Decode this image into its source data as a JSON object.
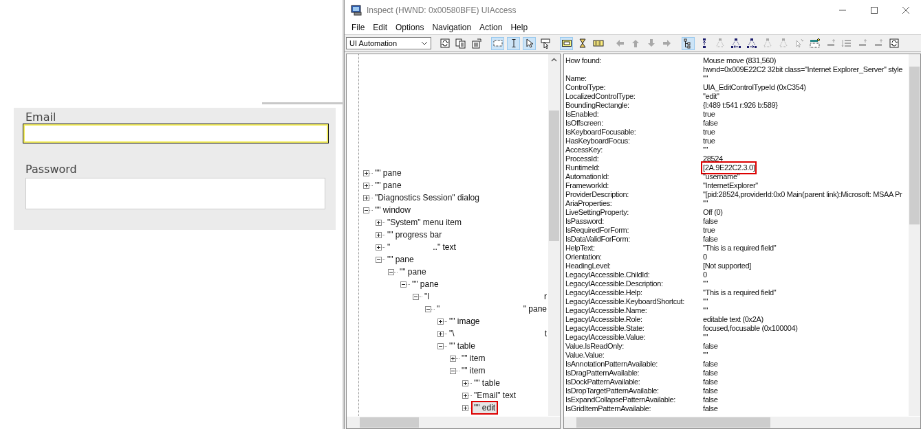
{
  "web_form": {
    "fields": [
      {
        "label": "Email",
        "focused": true
      },
      {
        "label": "Password",
        "focused": false
      }
    ]
  },
  "window": {
    "title": "Inspect  (HWND: 0x00580BFE) UIAccess",
    "menu": [
      "File",
      "Edit",
      "Options",
      "Navigation",
      "Action",
      "Help"
    ],
    "mode_dropdown": {
      "value": "UI Automation"
    },
    "toolbar": [
      [
        {
          "kind": "refresh",
          "selected": false,
          "disabled": false
        },
        {
          "kind": "copy",
          "selected": false,
          "disabled": false
        },
        {
          "kind": "properties",
          "selected": false,
          "disabled": false
        }
      ],
      [
        {
          "kind": "rectangle",
          "selected": true,
          "disabled": false
        },
        {
          "kind": "ibeam",
          "selected": true,
          "disabled": false
        },
        {
          "kind": "pointer",
          "selected": true,
          "disabled": false
        },
        {
          "kind": "hover",
          "selected": false,
          "disabled": false
        }
      ],
      [
        {
          "kind": "highlight",
          "selected": true,
          "disabled": false
        },
        {
          "kind": "hourglass",
          "selected": false,
          "disabled": false
        },
        {
          "kind": "keyboard",
          "selected": false,
          "disabled": false
        }
      ],
      [
        {
          "kind": "arrow-left",
          "selected": false,
          "disabled": true
        },
        {
          "kind": "arrow-up",
          "selected": false,
          "disabled": true
        },
        {
          "kind": "arrow-down",
          "selected": false,
          "disabled": true
        },
        {
          "kind": "arrow-right",
          "selected": false,
          "disabled": true
        }
      ],
      [
        {
          "kind": "tree",
          "selected": true,
          "disabled": false
        },
        {
          "kind": "node-up",
          "selected": false,
          "disabled": false
        },
        {
          "kind": "node-tree",
          "selected": false,
          "disabled": true
        },
        {
          "kind": "node-left",
          "selected": false,
          "disabled": false
        },
        {
          "kind": "node-right",
          "selected": false,
          "disabled": false
        },
        {
          "kind": "node-tree",
          "selected": false,
          "disabled": true
        },
        {
          "kind": "node-tree",
          "selected": false,
          "disabled": true
        },
        {
          "kind": "sparkle",
          "selected": false,
          "disabled": true
        },
        {
          "kind": "marker",
          "selected": false,
          "disabled": false
        },
        {
          "kind": "line-add",
          "selected": false,
          "disabled": true
        },
        {
          "kind": "list",
          "selected": false,
          "disabled": true
        },
        {
          "kind": "line-add",
          "selected": false,
          "disabled": true
        },
        {
          "kind": "line-add",
          "selected": false,
          "disabled": true
        },
        {
          "kind": "refresh",
          "selected": false,
          "disabled": false
        }
      ]
    ]
  },
  "tree": [
    {
      "label": "\"\" pane",
      "expanded": false,
      "selected": false
    },
    {
      "label": "\"\" pane",
      "expanded": false,
      "selected": false
    },
    {
      "label": "\"Diagnostics Session\" dialog",
      "expanded": false,
      "selected": false
    },
    {
      "label": "\"\" window",
      "expanded": true,
      "selected": false,
      "children": [
        {
          "label": "\"System\" menu item",
          "expanded": false,
          "selected": false
        },
        {
          "label": "\"\" progress bar",
          "expanded": false,
          "selected": false
        },
        {
          "label": "\"",
          "tail_mid": "..\" text",
          "expanded": false,
          "selected": false
        },
        {
          "label": "\"\" pane",
          "expanded": true,
          "selected": false,
          "children": [
            {
              "label": "\"\" pane",
              "expanded": true,
              "selected": false,
              "children": [
                {
                  "label": "\"\" pane",
                  "expanded": true,
                  "selected": false,
                  "children": [
                    {
                      "label": "\"l",
                      "tail": "r",
                      "expanded": true,
                      "selected": false,
                      "children": [
                        {
                          "label": "\"",
                          "tail": "\" pane",
                          "expanded": true,
                          "selected": false,
                          "children": [
                            {
                              "label": "\"\" image",
                              "expanded": false,
                              "selected": false
                            },
                            {
                              "label": "\"\\",
                              "tail": "t",
                              "expanded": false,
                              "selected": false
                            },
                            {
                              "label": "\"\" table",
                              "expanded": true,
                              "selected": false,
                              "children": [
                                {
                                  "label": "\"\" item",
                                  "expanded": false,
                                  "selected": false
                                },
                                {
                                  "label": "\"\" item",
                                  "expanded": true,
                                  "selected": false,
                                  "children": [
                                    {
                                      "label": "\"\" table",
                                      "expanded": false,
                                      "selected": false
                                    },
                                    {
                                      "label": "\"Email\" text",
                                      "expanded": false,
                                      "selected": false
                                    },
                                    {
                                      "label": "\"\" edit",
                                      "expanded": false,
                                      "selected": true
                                    }
                                  ]
                                }
                              ]
                            }
                          ]
                        }
                      ]
                    }
                  ]
                }
              ]
            }
          ]
        }
      ]
    }
  ],
  "properties": [
    {
      "name": "How found:",
      "value": "Mouse move (831,560)",
      "highlighted": false
    },
    {
      "value": "hwnd=0x009E22C2 32bit class=\"Internet Explorer_Server\" style",
      "highlighted": false
    },
    {
      "name": "Name:",
      "value": "\"\"",
      "highlighted": false
    },
    {
      "name": "ControlType:",
      "value": "UIA_EditControlTypeId (0xC354)",
      "highlighted": false
    },
    {
      "name": "LocalizedControlType:",
      "value": "\"edit\"",
      "highlighted": false
    },
    {
      "name": "BoundingRectangle:",
      "value": "{l:489 t:541 r:926 b:589}",
      "highlighted": false
    },
    {
      "name": "IsEnabled:",
      "value": "true",
      "highlighted": false
    },
    {
      "name": "IsOffscreen:",
      "value": "false",
      "highlighted": false
    },
    {
      "name": "IsKeyboardFocusable:",
      "value": "true",
      "highlighted": false
    },
    {
      "name": "HasKeyboardFocus:",
      "value": "true",
      "highlighted": false
    },
    {
      "name": "AccessKey:",
      "value": "\"\"",
      "highlighted": false
    },
    {
      "name": "ProcessId:",
      "value": "28524",
      "highlighted": false
    },
    {
      "name": "RuntimeId:",
      "value": "[2A.9E22C2.3.0]",
      "highlighted": true
    },
    {
      "name": "AutomationId:",
      "value": "\"username\"",
      "highlighted": false
    },
    {
      "name": "FrameworkId:",
      "value": "\"InternetExplorer\"",
      "highlighted": false
    },
    {
      "name": "ProviderDescription:",
      "value": "\"[pid:28524,providerId:0x0 Main(parent link):Microsoft: MSAA Pr",
      "highlighted": false
    },
    {
      "name": "AriaProperties:",
      "value": "\"\"",
      "highlighted": false
    },
    {
      "name": "LiveSettingProperty:",
      "value": "Off (0)",
      "highlighted": false
    },
    {
      "name": "IsPassword:",
      "value": "false",
      "highlighted": false
    },
    {
      "name": "IsRequiredForForm:",
      "value": "true",
      "highlighted": false
    },
    {
      "name": "IsDataValidForForm:",
      "value": "false",
      "highlighted": false
    },
    {
      "name": "HelpText:",
      "value": "\"This is a required field\"",
      "highlighted": false
    },
    {
      "name": "Orientation:",
      "value": "0",
      "highlighted": false
    },
    {
      "name": "HeadingLevel:",
      "value": "[Not supported]",
      "highlighted": false
    },
    {
      "name": "LegacyIAccessible.ChildId:",
      "value": "0",
      "highlighted": false
    },
    {
      "name": "LegacyIAccessible.Description:",
      "value": "\"\"",
      "highlighted": false
    },
    {
      "name": "LegacyIAccessible.Help:",
      "value": "\"This is a required field\"",
      "highlighted": false
    },
    {
      "name": "LegacyIAccessible.KeyboardShortcut:",
      "value": "\"\"",
      "highlighted": false
    },
    {
      "name": "LegacyIAccessible.Name:",
      "value": "\"\"",
      "highlighted": false
    },
    {
      "name": "LegacyIAccessible.Role:",
      "value": "editable text (0x2A)",
      "highlighted": false
    },
    {
      "name": "LegacyIAccessible.State:",
      "value": "focused,focusable (0x100004)",
      "highlighted": false
    },
    {
      "name": "LegacyIAccessible.Value:",
      "value": "\"\"",
      "highlighted": false
    },
    {
      "name": "Value.IsReadOnly:",
      "value": "false",
      "highlighted": false
    },
    {
      "name": "Value.Value:",
      "value": "\"\"",
      "highlighted": false
    },
    {
      "name": "IsAnnotationPatternAvailable:",
      "value": "false",
      "highlighted": false
    },
    {
      "name": "IsDragPatternAvailable:",
      "value": "false",
      "highlighted": false
    },
    {
      "name": "IsDockPatternAvailable:",
      "value": "false",
      "highlighted": false
    },
    {
      "name": "IsDropTargetPatternAvailable:",
      "value": "false",
      "highlighted": false
    },
    {
      "name": "IsExpandCollapsePatternAvailable:",
      "value": "false",
      "highlighted": false
    },
    {
      "name": "IsGridItemPatternAvailable:",
      "value": "false",
      "highlighted": false
    }
  ]
}
